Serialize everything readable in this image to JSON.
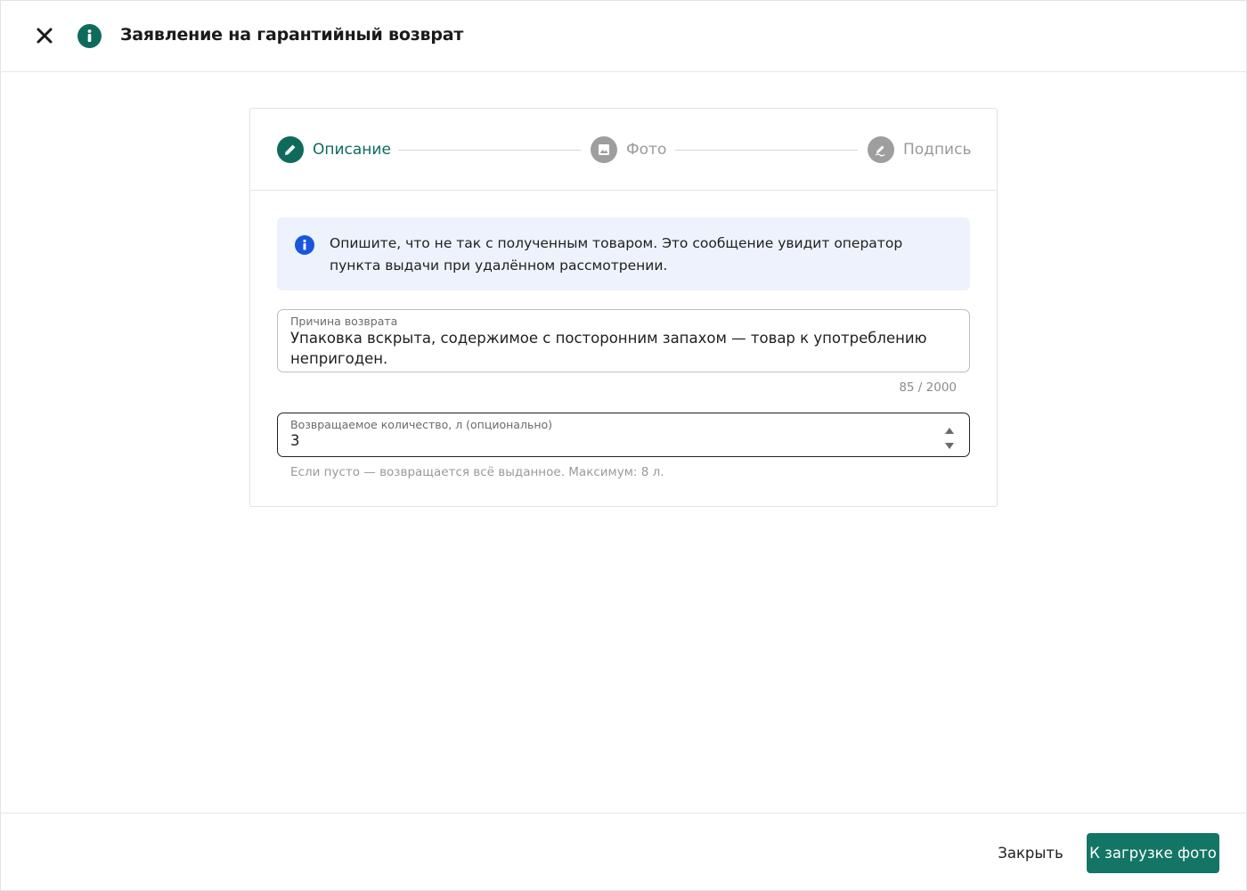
{
  "header": {
    "title": "Заявление на гарантийный возврат"
  },
  "stepper": {
    "steps": [
      {
        "label": "Описание",
        "state": "active",
        "icon": "pencil-icon"
      },
      {
        "label": "Фото",
        "state": "inactive",
        "icon": "image-icon"
      },
      {
        "label": "Подпись",
        "state": "inactive",
        "icon": "signature-icon"
      }
    ]
  },
  "info": {
    "text": "Опишите, что не так с полученным товаром. Это сообщение увидит оператор пункта выдачи при удалённом рассмотрении."
  },
  "reason": {
    "label": "Причина возврата",
    "value": "Упаковка вскрыта, содержимое с посторонним запахом — товар к употреблению непригоден.",
    "counter": "85 / 2000"
  },
  "quantity": {
    "label": "Возвращаемое количество, л (опционально)",
    "value": "3",
    "helper": "Если пусто — возвращается всё выданное. Максимум: 8 л."
  },
  "footer": {
    "close_label": "Закрыть",
    "primary_label": "К загрузке фото"
  },
  "colors": {
    "accent": "#0e6b5c",
    "primary_button": "#137566",
    "info_bg": "#edf2fc",
    "info_icon": "#1a56db",
    "inactive": "#9e9e9e"
  }
}
